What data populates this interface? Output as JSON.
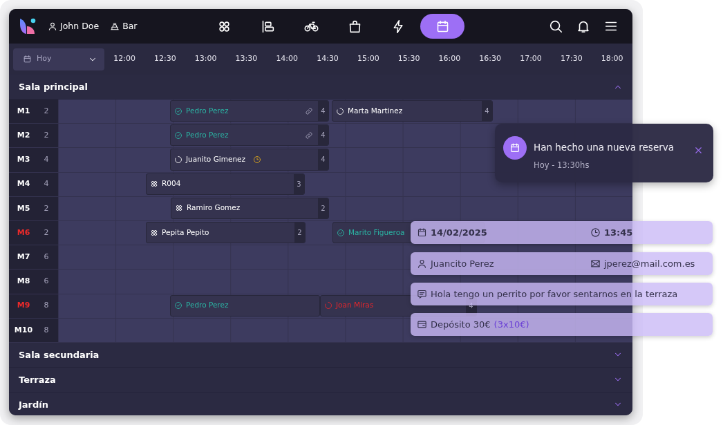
{
  "nav": {
    "user": "John Doe",
    "venue": "Bar",
    "items": [
      {
        "selected": false
      },
      {
        "selected": false
      },
      {
        "selected": false
      },
      {
        "selected": false
      },
      {
        "selected": false
      },
      {
        "selected": true
      }
    ]
  },
  "toolbar": {
    "date_picker": {
      "value": "Hoy"
    },
    "times": [
      "12:00",
      "12:30",
      "13:00",
      "13:30",
      "14:00",
      "14:30",
      "15:00",
      "15:30",
      "16:00",
      "16:30",
      "17:00",
      "17:30",
      "18:00"
    ]
  },
  "sections": [
    {
      "title": "Sala principal",
      "expanded": true,
      "tables": [
        {
          "name": "M1",
          "seats": "2",
          "alert": false,
          "bookings": [
            {
              "name": "Pedro Perez",
              "kind": "confirmed",
              "linked": true,
              "late": false,
              "count": "4"
            },
            {
              "name": "Marta Martinez",
              "kind": "pending",
              "linked": false,
              "late": false,
              "count": "4"
            }
          ]
        },
        {
          "name": "M2",
          "seats": "2",
          "alert": false,
          "bookings": [
            {
              "name": "Pedro Perez",
              "kind": "confirmed",
              "linked": true,
              "late": false,
              "count": "4"
            }
          ]
        },
        {
          "name": "M3",
          "seats": "4",
          "alert": false,
          "bookings": [
            {
              "name": "Juanito Gimenez",
              "kind": "pending",
              "linked": false,
              "late": true,
              "count": "4"
            }
          ]
        },
        {
          "name": "M4",
          "seats": "4",
          "alert": false,
          "bookings": [
            {
              "name": "R004",
              "kind": "walkin",
              "linked": false,
              "late": false,
              "count": "3"
            }
          ]
        },
        {
          "name": "M5",
          "seats": "2",
          "alert": false,
          "bookings": [
            {
              "name": "Ramiro Gomez",
              "kind": "walkin",
              "linked": false,
              "late": false,
              "count": "2"
            }
          ]
        },
        {
          "name": "M6",
          "seats": "2",
          "alert": true,
          "bookings": [
            {
              "name": "Pepita Pepito",
              "kind": "walkin",
              "linked": false,
              "late": false,
              "count": "2"
            },
            {
              "name": "Marito Figueroa",
              "kind": "confirmed",
              "linked": false,
              "late": false
            }
          ]
        },
        {
          "name": "M7",
          "seats": "6",
          "alert": false
        },
        {
          "name": "M8",
          "seats": "6",
          "alert": false
        },
        {
          "name": "M9",
          "seats": "8",
          "alert": true,
          "bookings": [
            {
              "name": "Pedro Perez",
              "kind": "confirmed",
              "linked": false,
              "late": false
            },
            {
              "name": "Joan Miras",
              "kind": "cancelled",
              "linked": false,
              "late": false,
              "count": "4"
            }
          ]
        },
        {
          "name": "M10",
          "seats": "8",
          "alert": false
        }
      ]
    },
    {
      "title": "Sala secundaria",
      "expanded": false
    },
    {
      "title": "Terraza",
      "expanded": false
    },
    {
      "title": "Jardín",
      "expanded": false
    }
  ],
  "notification": {
    "title": "Han hecho una nueva reserva",
    "subtitle": "Hoy - 13:30hs"
  },
  "booking_detail": {
    "date": "14/02/2025",
    "time": "13:45",
    "customer": "Juancito Perez",
    "email": "jperez@mail.com.es",
    "note": "Hola tengo un perrito por favor sentarnos en la terraza",
    "deposit": "Depósito 30€",
    "deposit_detail": "(3x10€)"
  }
}
